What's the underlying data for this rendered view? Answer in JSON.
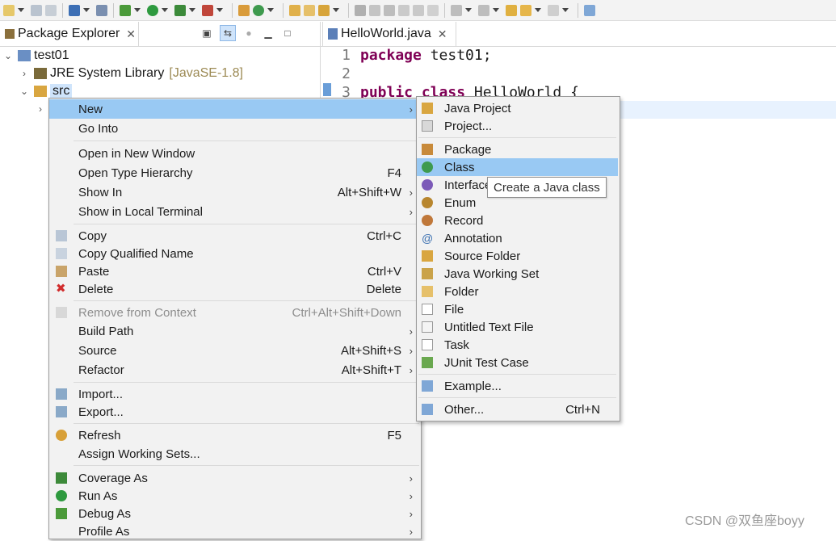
{
  "package_explorer": {
    "tab_label": "Package Explorer",
    "tree": {
      "project": "test01",
      "library": "JRE System Library",
      "library_decoration": "[JavaSE-1.8]",
      "folder": "src"
    }
  },
  "editor": {
    "tab_label": "HelloWorld.java",
    "lines": [
      {
        "num": "1",
        "kw": "package",
        "rest": " test01;"
      },
      {
        "num": "2",
        "kw": "",
        "rest": ""
      },
      {
        "num": "3",
        "kw": "public class",
        "rest": " HelloWorld {"
      }
    ]
  },
  "context_menu": {
    "new": "New",
    "go_into": "Go Into",
    "open_new_window": "Open in New Window",
    "open_type_hierarchy": "Open Type Hierarchy",
    "open_type_hierarchy_acc": "F4",
    "show_in": "Show In",
    "show_in_acc": "Alt+Shift+W",
    "show_in_terminal": "Show in Local Terminal",
    "copy": "Copy",
    "copy_acc": "Ctrl+C",
    "copy_qualified": "Copy Qualified Name",
    "paste": "Paste",
    "paste_acc": "Ctrl+V",
    "delete": "Delete",
    "delete_acc": "Delete",
    "remove_context": "Remove from Context",
    "remove_context_acc": "Ctrl+Alt+Shift+Down",
    "build_path": "Build Path",
    "source": "Source",
    "source_acc": "Alt+Shift+S",
    "refactor": "Refactor",
    "refactor_acc": "Alt+Shift+T",
    "import": "Import...",
    "export": "Export...",
    "refresh": "Refresh",
    "refresh_acc": "F5",
    "assign_sets": "Assign Working Sets...",
    "coverage_as": "Coverage As",
    "run_as": "Run As",
    "debug_as": "Debug As",
    "profile_as": "Profile As"
  },
  "new_submenu": {
    "java_project": "Java Project",
    "project": "Project...",
    "package": "Package",
    "class": "Class",
    "interface": "Interface",
    "enum": "Enum",
    "record": "Record",
    "annotation": "Annotation",
    "source_folder": "Source Folder",
    "java_working_set": "Java Working Set",
    "folder": "Folder",
    "file": "File",
    "untitled_text_file": "Untitled Text File",
    "task": "Task",
    "junit_test_case": "JUnit Test Case",
    "example": "Example...",
    "other": "Other...",
    "other_acc": "Ctrl+N"
  },
  "tooltip": "Create a Java class",
  "watermark": "CSDN @双鱼座boyy",
  "colors": {
    "highlight": "#99c9f3",
    "keyword": "#7f0055",
    "menu_bg": "#f2f2f2"
  }
}
